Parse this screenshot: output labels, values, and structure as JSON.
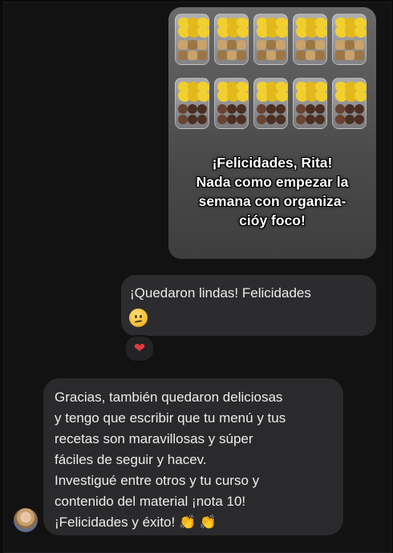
{
  "shared_image": {
    "overlay_lines": [
      "¡Felicidades, Rita!",
      "Nada como empezar la",
      "semana con organiza-",
      "cióy foco!"
    ]
  },
  "outgoing_message": {
    "text": "¡Quedaron lindas! Felicidades",
    "emoji_icon": "slight-smile-face-icon",
    "reaction": "❤"
  },
  "incoming_message": {
    "lines": [
      "Gracias, también quedaron deliciosas",
      "y tengo que escribir que tu menú y tus",
      "recetas son maravillosas y súper",
      "fáciles de seguir y hacev.",
      "Investigué entre otros y tu curso y",
      "contenido del material ¡nota 10!",
      "¡Felicidades y éxito!"
    ],
    "trailing_emoji": "👏 👏",
    "avatar_icon": "user-avatar-icon"
  },
  "colors": {
    "background": "#121213",
    "bubble": "#2c2c2e",
    "text": "#ececec",
    "heart": "#e5383b"
  }
}
